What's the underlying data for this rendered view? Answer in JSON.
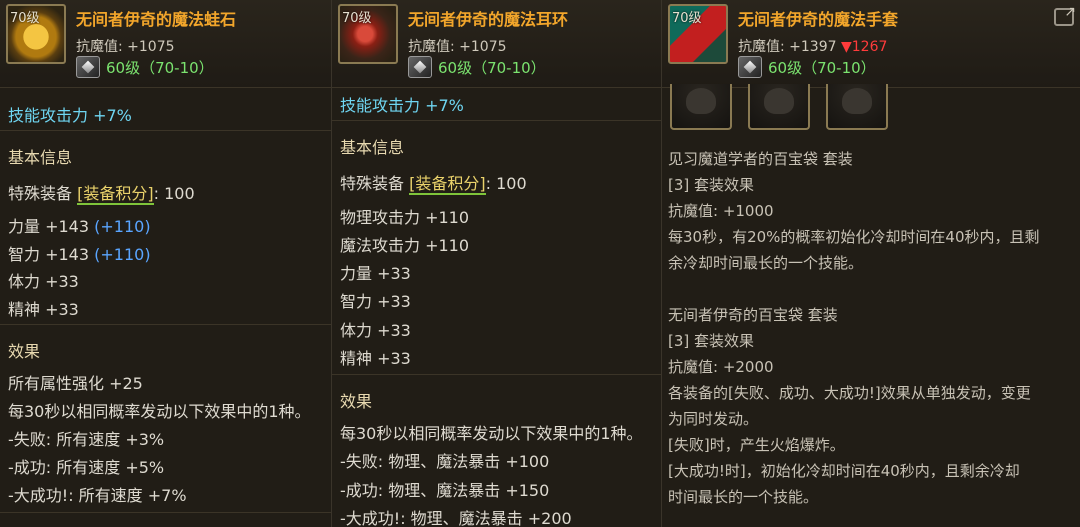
{
  "items": [
    {
      "level_tag": "70级",
      "title": "无间者伊奇的魔法蛙石",
      "stat": "抗魔值: +1075",
      "grade": "60级（70-10）",
      "body": {
        "skill_atk": "技能攻击力 +7%",
        "basic_info": "基本信息",
        "special_prefix": "特殊装备",
        "equip_score": "[装备积分]",
        "score_value": ": 100",
        "str_base": "力量 +143",
        "str_bonus": "(+110)",
        "int_base": "智力 +143",
        "int_bonus": "(+110)",
        "vit": "体力 +33",
        "spi": "精神 +33",
        "effect_title": "效果",
        "e1": "所有属性强化 +25",
        "e2": "每30秒以相同概率发动以下效果中的1种。",
        "e3": "-失败: 所有速度 +3%",
        "e4": "-成功: 所有速度 +5%",
        "e5": "-大成功!: 所有速度 +7%"
      }
    },
    {
      "level_tag": "70级",
      "title": "无间者伊奇的魔法耳环",
      "stat": "抗魔值: +1075",
      "grade": "60级（70-10）",
      "body": {
        "skill_atk": "技能攻击力 +7%",
        "basic_info": "基本信息",
        "special_prefix": "特殊装备",
        "equip_score": "[装备积分]",
        "score_value": ": 100",
        "phys": "物理攻击力 +110",
        "mag": "魔法攻击力 +110",
        "str": "力量 +33",
        "int": "智力 +33",
        "vit": "体力 +33",
        "spi": "精神 +33",
        "effect_title": "效果",
        "e1": "每30秒以相同概率发动以下效果中的1种。",
        "e2": "-失败: 物理、魔法暴击 +100",
        "e3": "-成功: 物理、魔法暴击 +150",
        "e4": "-大成功!: 物理、魔法暴击 +200"
      }
    },
    {
      "level_tag": "70级",
      "title": "无间者伊奇的魔法手套",
      "stat_prefix": "抗魔值: +1397",
      "stat_diff": "▼1267",
      "grade": "60级（70-10）",
      "body": {
        "set1_name": "见习魔道学者的百宝袋 套装",
        "set1_effect": "[3] 套装效果",
        "set1_stat": "抗魔值: +1000",
        "set1_desc1": "每30秒，有20%的概率初始化冷却时间在40秒内，且剩",
        "set1_desc2": "余冷却时间最长的一个技能。",
        "set2_name": "无间者伊奇的百宝袋 套装",
        "set2_effect": "[3] 套装效果",
        "set2_stat": "抗魔值: +2000",
        "set2_desc1": "各装备的[失败、成功、大成功!]效果从单独发动，变更",
        "set2_desc2": "为同时发动。",
        "set2_desc3": "[失败]时，产生火焰爆炸。",
        "set2_desc4": "[大成功!时]，初始化冷却时间在40秒内，且剩余冷却",
        "set2_desc5": "时间最长的一个技能。"
      }
    }
  ],
  "colors": {
    "title": "#f2a62b",
    "grade": "#7be36f",
    "skill": "#6fd6f2",
    "bonus": "#5aa5ff",
    "down": "#ff3b3b"
  },
  "icons": [
    "frog-stone-icon",
    "earring-icon",
    "glove-icon",
    "diamond-grade-icon",
    "export-icon"
  ]
}
